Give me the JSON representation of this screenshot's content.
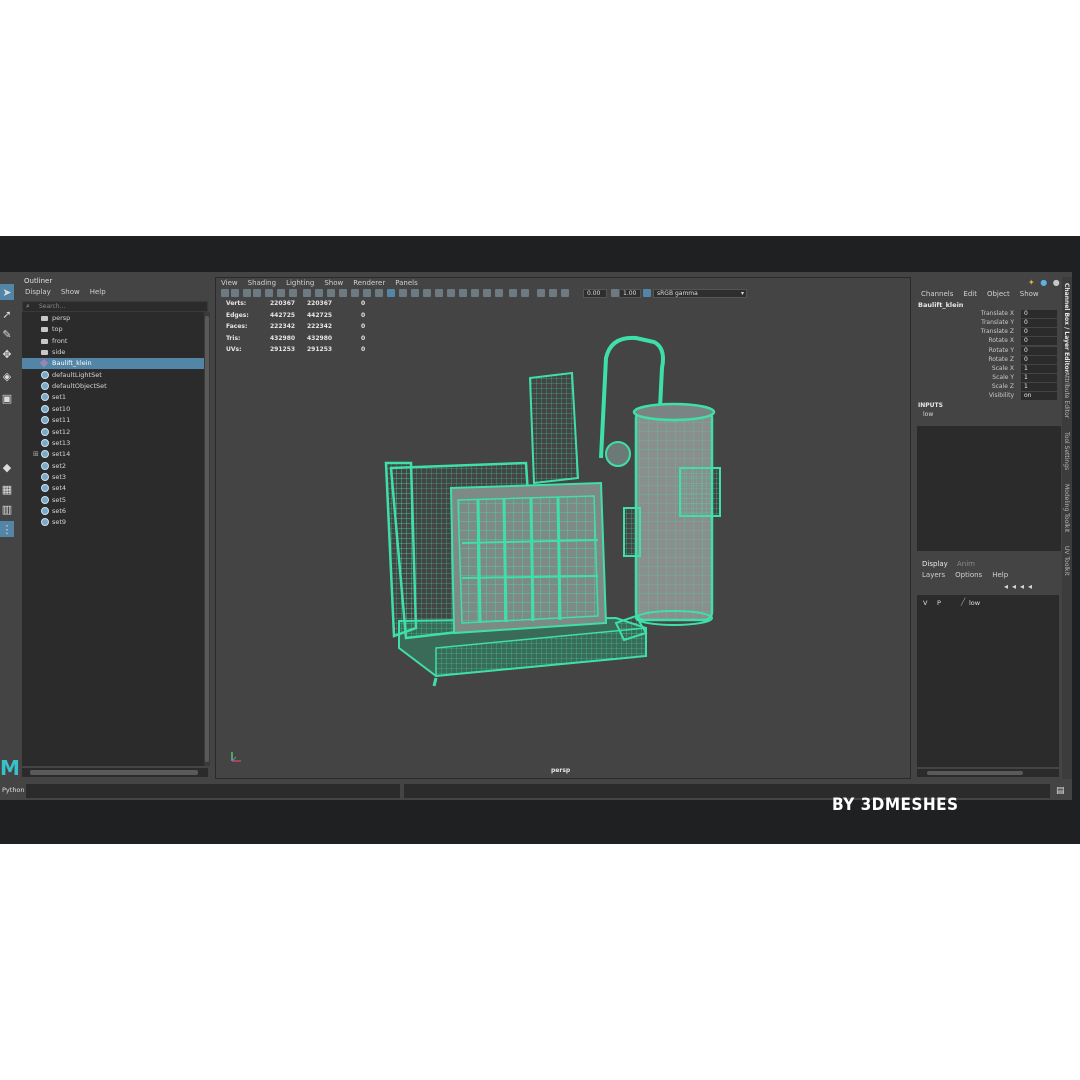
{
  "outliner": {
    "title": "Outliner",
    "menu": [
      "Display",
      "Show",
      "Help"
    ],
    "search_placeholder": "Search...",
    "items": [
      {
        "label": "persp",
        "type": "camera"
      },
      {
        "label": "top",
        "type": "camera"
      },
      {
        "label": "front",
        "type": "camera"
      },
      {
        "label": "side",
        "type": "camera"
      },
      {
        "label": "Baulift_klein",
        "type": "mesh",
        "selected": true
      },
      {
        "label": "defaultLightSet",
        "type": "set"
      },
      {
        "label": "defaultObjectSet",
        "type": "set"
      },
      {
        "label": "set1",
        "type": "set"
      },
      {
        "label": "set10",
        "type": "set"
      },
      {
        "label": "set11",
        "type": "set"
      },
      {
        "label": "set12",
        "type": "set"
      },
      {
        "label": "set13",
        "type": "set"
      },
      {
        "label": "set14",
        "type": "set",
        "expandable": true
      },
      {
        "label": "set2",
        "type": "set"
      },
      {
        "label": "set3",
        "type": "set"
      },
      {
        "label": "set4",
        "type": "set"
      },
      {
        "label": "set5",
        "type": "set"
      },
      {
        "label": "set6",
        "type": "set"
      },
      {
        "label": "set9",
        "type": "set"
      }
    ]
  },
  "viewport": {
    "menu": [
      "View",
      "Shading",
      "Lighting",
      "Show",
      "Renderer",
      "Panels"
    ],
    "exposure": "0.00",
    "gamma": "1.00",
    "colorspace": "sRGB gamma",
    "camera_label": "persp",
    "hud": [
      {
        "label": "Verts:",
        "a": "220367",
        "b": "220367",
        "c": "0"
      },
      {
        "label": "Edges:",
        "a": "442725",
        "b": "442725",
        "c": "0"
      },
      {
        "label": "Faces:",
        "a": "222342",
        "b": "222342",
        "c": "0"
      },
      {
        "label": "Tris:",
        "a": "432980",
        "b": "432980",
        "c": "0"
      },
      {
        "label": "UVs:",
        "a": "291253",
        "b": "291253",
        "c": "0"
      }
    ]
  },
  "channel_box": {
    "menu": [
      "Channels",
      "Edit",
      "Object",
      "Show"
    ],
    "object_name": "Baulift_klein",
    "channels": [
      {
        "label": "Translate X",
        "value": "0"
      },
      {
        "label": "Translate Y",
        "value": "0"
      },
      {
        "label": "Translate Z",
        "value": "0"
      },
      {
        "label": "Rotate X",
        "value": "0"
      },
      {
        "label": "Rotate Y",
        "value": "0"
      },
      {
        "label": "Rotate Z",
        "value": "0"
      },
      {
        "label": "Scale X",
        "value": "1"
      },
      {
        "label": "Scale Y",
        "value": "1"
      },
      {
        "label": "Scale Z",
        "value": "1"
      },
      {
        "label": "Visibility",
        "value": "on"
      }
    ],
    "inputs_header": "INPUTS",
    "inputs_item": "low"
  },
  "layer_editor": {
    "tabs": [
      "Display",
      "Anim"
    ],
    "menu": [
      "Layers",
      "Options",
      "Help"
    ],
    "layer": {
      "v": "V",
      "p": "P",
      "name": "low"
    }
  },
  "side_tabs": [
    "Channel Box / Layer Editor",
    "Attribute Editor",
    "Tool Settings",
    "Modeling Toolkit",
    "UV Toolkit"
  ],
  "command_line": {
    "label": "Python"
  },
  "watermark": "BY 3DMESHES",
  "colors": {
    "wire": "#3fe0a8",
    "selection": "#5285a6"
  }
}
